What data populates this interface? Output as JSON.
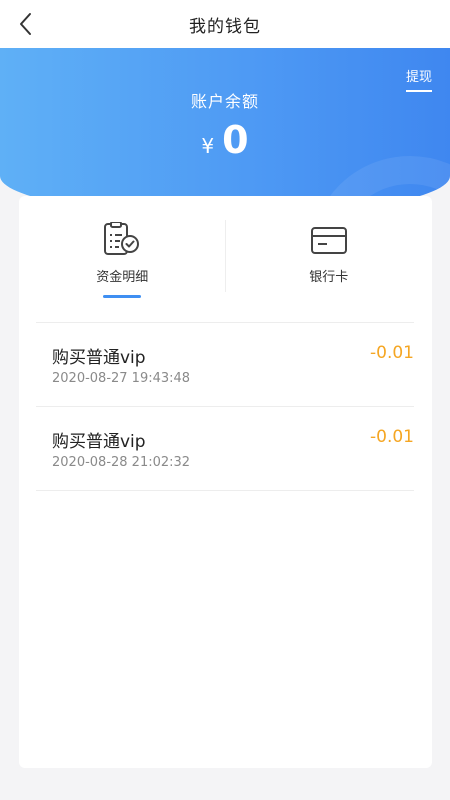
{
  "header": {
    "title": "我的钱包",
    "back_icon": "chevron-left-icon"
  },
  "banner": {
    "withdraw_label": "提现",
    "balance_label": "账户余额",
    "currency_symbol": "¥",
    "balance_value": "0",
    "accent_color": "#4e9af4"
  },
  "tabs": [
    {
      "label": "资金明细",
      "icon": "document-check-icon",
      "active": true
    },
    {
      "label": "银行卡",
      "icon": "bank-card-icon",
      "active": false
    }
  ],
  "transactions": [
    {
      "title": "购买普通vip",
      "time": "2020-08-27 19:43:48",
      "amount": "-0.01"
    },
    {
      "title": "购买普通vip",
      "time": "2020-08-28 21:02:32",
      "amount": "-0.01"
    }
  ],
  "colors": {
    "amount": "#f5a623",
    "indicator": "#3f8ff2"
  }
}
